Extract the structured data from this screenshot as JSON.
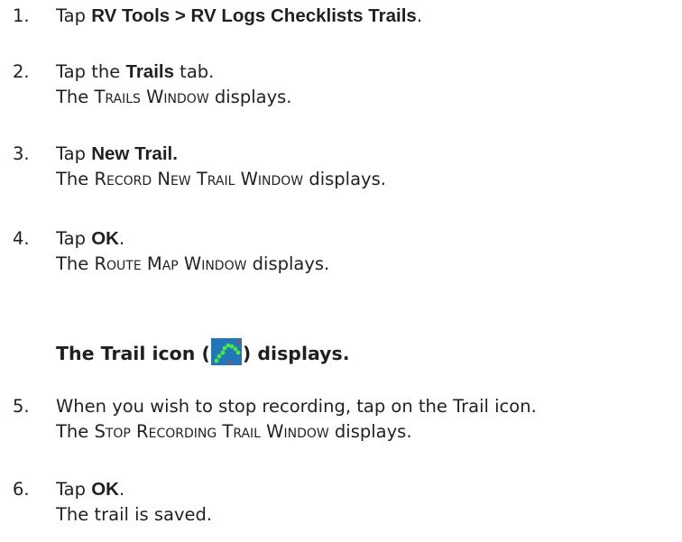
{
  "steps": [
    {
      "number": "1.",
      "pre": "Tap ",
      "bold": "RV Tools > RV Logs Checklists Trails",
      "post": "."
    },
    {
      "number": "2.",
      "pre": "Tap the ",
      "bold": "Trails",
      "post": " tab.",
      "result_pre": "The ",
      "result_window": "Trails Window",
      "result_post": " displays."
    },
    {
      "number": "3.",
      "pre": "Tap ",
      "bold": "New Trail.",
      "post": "",
      "result_pre": "The ",
      "result_window": "Record New Trail Window",
      "result_post": " displays."
    },
    {
      "number": "4.",
      "pre": "Tap ",
      "bold": "OK",
      "post": ".",
      "result_pre": "The ",
      "result_window": "Route Map Window",
      "result_post": " displays."
    },
    {
      "number": "5.",
      "text": "When you wish to stop recording, tap on the Trail icon.",
      "result_pre": "The ",
      "result_window": "Stop Recording Trail Window",
      "result_post": " displays."
    },
    {
      "number": "6.",
      "pre": "Tap ",
      "bold": "OK",
      "post": ".",
      "result_text": "The trail is saved."
    }
  ],
  "trail_note": {
    "pre": "The Trail icon (",
    "icon": "trail-icon",
    "post": ") displays."
  },
  "colors": {
    "text": "#231f20",
    "icon_bg": "#1a6fb0",
    "icon_dots": "#3ddc3d"
  }
}
